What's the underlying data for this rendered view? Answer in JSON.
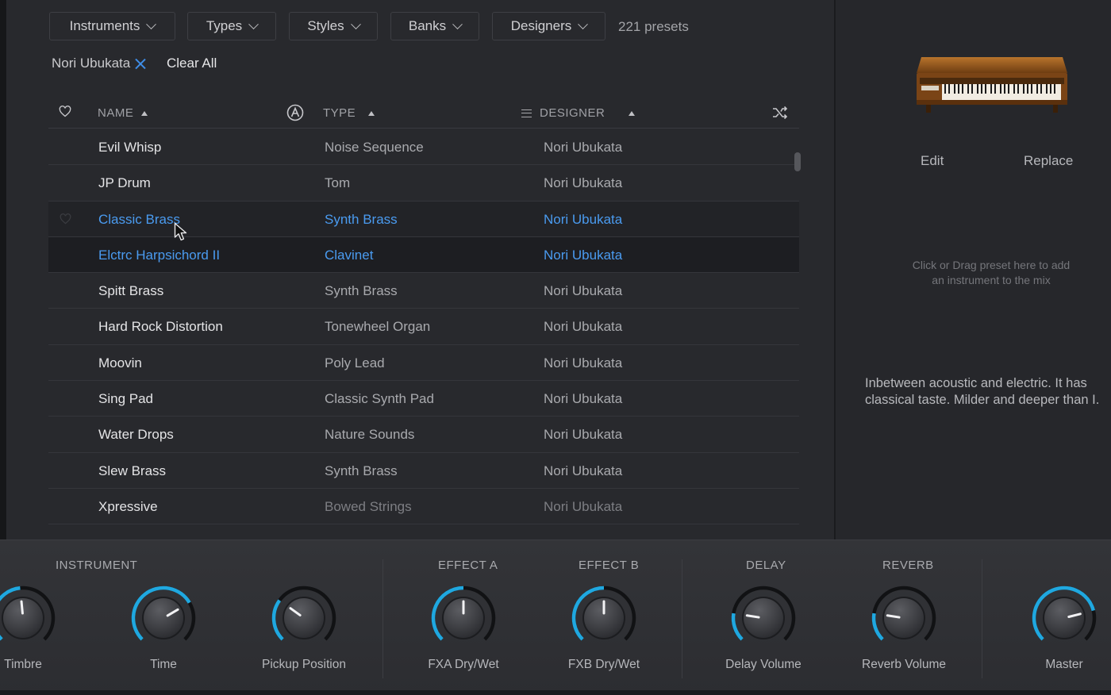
{
  "filters": {
    "instruments_label": "Instruments",
    "types_label": "Types",
    "styles_label": "Styles",
    "banks_label": "Banks",
    "designers_label": "Designers",
    "preset_count": "221 presets"
  },
  "active_tag": {
    "label": "Nori Ubukata"
  },
  "clear_all_label": "Clear All",
  "table": {
    "columns": {
      "name": "NAME",
      "type": "TYPE",
      "designer": "DESIGNER"
    },
    "rows": [
      {
        "name": "Evil Whisp",
        "type": "Noise Sequence",
        "designer": "Nori Ubukata"
      },
      {
        "name": "JP Drum",
        "type": "Tom",
        "designer": "Nori Ubukata"
      },
      {
        "name": "Classic Brass",
        "type": "Synth Brass",
        "designer": "Nori Ubukata"
      },
      {
        "name": "Elctrc Harpsichord II",
        "type": "Clavinet",
        "designer": "Nori Ubukata"
      },
      {
        "name": "Spitt Brass",
        "type": "Synth Brass",
        "designer": "Nori Ubukata"
      },
      {
        "name": "Hard Rock Distortion",
        "type": "Tonewheel Organ",
        "designer": "Nori Ubukata"
      },
      {
        "name": "Moovin",
        "type": "Poly Lead",
        "designer": "Nori Ubukata"
      },
      {
        "name": "Sing Pad",
        "type": "Classic Synth Pad",
        "designer": "Nori Ubukata"
      },
      {
        "name": "Water Drops",
        "type": "Nature Sounds",
        "designer": "Nori Ubukata"
      },
      {
        "name": "Slew Brass",
        "type": "Synth Brass",
        "designer": "Nori Ubukata"
      },
      {
        "name": "Xpressive",
        "type": "Bowed Strings",
        "designer": "Nori Ubukata"
      },
      {
        "name": "",
        "type": "",
        "designer": ""
      }
    ]
  },
  "right_panel": {
    "edit_label": "Edit",
    "replace_label": "Replace",
    "drop_hint": "Click or Drag preset here to add an instrument to the mix",
    "description": "Inbetween acoustic and electric. It has classical taste. Milder and deeper than I."
  },
  "controls": {
    "sections": {
      "instrument": "INSTRUMENT",
      "effect_a": "EFFECT A",
      "effect_b": "EFFECT B",
      "delay": "DELAY",
      "reverb": "REVERB"
    },
    "knobs": [
      {
        "label": "Timbre",
        "value": 0.48
      },
      {
        "label": "Time",
        "value": 0.72
      },
      {
        "label": "Pickup Position",
        "value": 0.3
      },
      {
        "label": "FXA Dry/Wet",
        "value": 0.5
      },
      {
        "label": "FXB Dry/Wet",
        "value": 0.5
      },
      {
        "label": "Delay Volume",
        "value": 0.2
      },
      {
        "label": "Reverb Volume",
        "value": 0.2
      },
      {
        "label": "Master",
        "value": 0.78
      }
    ]
  },
  "colors": {
    "accent": "#3f8ee8",
    "knob_arc": "#1fa8e0"
  }
}
